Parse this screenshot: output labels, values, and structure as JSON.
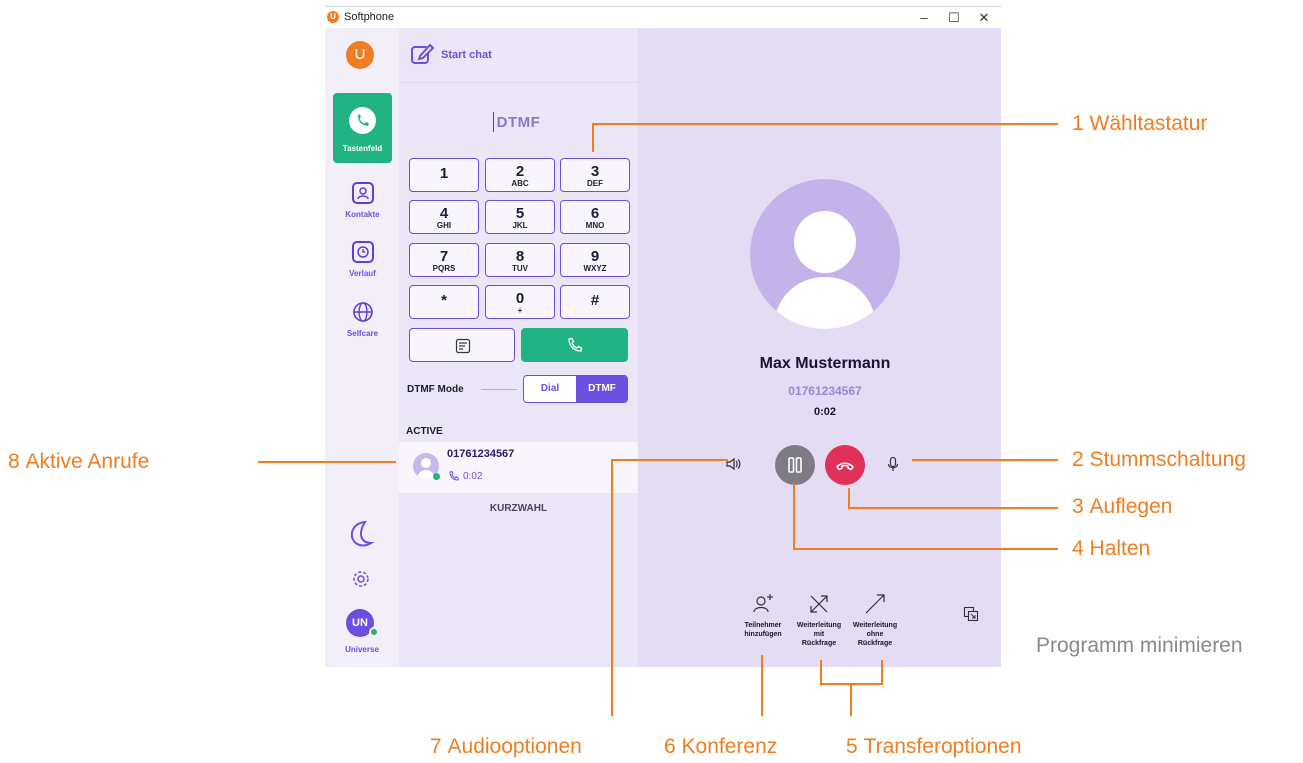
{
  "window": {
    "title": "Softphone",
    "controls": [
      "–",
      "☐",
      "✕"
    ]
  },
  "rail": {
    "logo": "U",
    "items": [
      {
        "label": "Tastenfeld",
        "icon": "phone-icon",
        "active": true
      },
      {
        "label": "Kontakte",
        "icon": "contacts-icon"
      },
      {
        "label": "Verlauf",
        "icon": "history-icon"
      },
      {
        "label": "Selfcare",
        "icon": "globe-icon"
      }
    ],
    "user_initials": "UN",
    "user_label": "Universe"
  },
  "dialer": {
    "start_chat": "Start chat",
    "display": "DTMF",
    "keys": [
      {
        "d": "1",
        "s": ""
      },
      {
        "d": "2",
        "s": "ABC"
      },
      {
        "d": "3",
        "s": "DEF"
      },
      {
        "d": "4",
        "s": "GHI"
      },
      {
        "d": "5",
        "s": "JKL"
      },
      {
        "d": "6",
        "s": "MNO"
      },
      {
        "d": "7",
        "s": "PQRS"
      },
      {
        "d": "8",
        "s": "TUV"
      },
      {
        "d": "9",
        "s": "WXYZ"
      },
      {
        "d": "*",
        "s": ""
      },
      {
        "d": "0",
        "s": "+"
      },
      {
        "d": "#",
        "s": ""
      }
    ],
    "dtmf_mode_label": "DTMF Mode",
    "mode_options": [
      "Dial",
      "DTMF"
    ],
    "active_header": "ACTIVE",
    "active_call": {
      "number": "01761234567",
      "duration": "0:02"
    },
    "speed_dial_header": "KURZWAHL"
  },
  "call": {
    "name": "Max Mustermann",
    "number": "01761234567",
    "timer": "0:02",
    "actions": [
      {
        "label_1": "Teilnehmer",
        "label_2": "hinzufügen",
        "label_3": ""
      },
      {
        "label_1": "Weiterleitung",
        "label_2": "mit",
        "label_3": "Rückfrage"
      },
      {
        "label_1": "Weiterleitung",
        "label_2": "ohne",
        "label_3": "Rückfrage"
      }
    ]
  },
  "annotations": [
    {
      "num": "1",
      "text": "Wähltastatur"
    },
    {
      "num": "2",
      "text": "Stummschaltung"
    },
    {
      "num": "3",
      "text": "Auflegen"
    },
    {
      "num": "4",
      "text": "Halten"
    },
    {
      "num": "5",
      "text": "Transferoptionen"
    },
    {
      "num": "6",
      "text": "Konferenz"
    },
    {
      "num": "7",
      "text": "Audiooptionen"
    },
    {
      "num": "8",
      "text": "Aktive Anrufe"
    }
  ],
  "minimize_label": "Programm minimieren",
  "colors": {
    "accent": "#6d4fe0",
    "green": "#22b384",
    "red": "#e03158",
    "annotation": "#ef7d22",
    "orange_brand": "#ef7d22"
  }
}
